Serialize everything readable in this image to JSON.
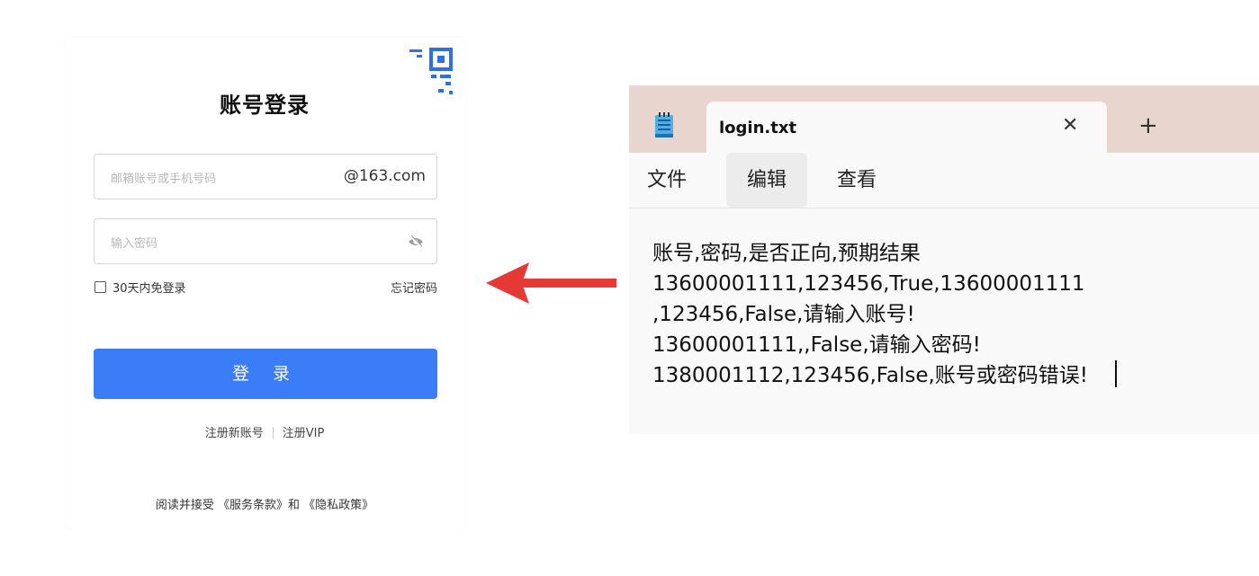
{
  "login": {
    "title": "账号登录",
    "username_placeholder": "邮箱账号或手机号码",
    "username_suffix": "@163.com",
    "password_placeholder": "输入密码",
    "remember_label": "30天内免登录",
    "forgot_label": "忘记密码",
    "login_button": "登 录",
    "register_link": "注册新账号",
    "register_vip_link": "注册VIP",
    "agreement_prefix": "阅读并接受",
    "terms_link": "《服务条款》",
    "agreement_and": "和",
    "privacy_link": "《隐私政策》"
  },
  "notepad": {
    "tab_title": "login.txt",
    "menu": [
      "文件",
      "编辑",
      "查看"
    ],
    "lines": [
      "账号,密码,是否正向,预期结果",
      "13600001111,123456,True,13600001111",
      ",123456,False,请输入账号!",
      "13600001111,,False,请输入密码!",
      "1380001112,123456,False,账号或密码错误!"
    ]
  },
  "colors": {
    "login_button": "#3b7cf7",
    "arrow": "#e53935",
    "notepad_titlebar": "#e8d5cd"
  }
}
